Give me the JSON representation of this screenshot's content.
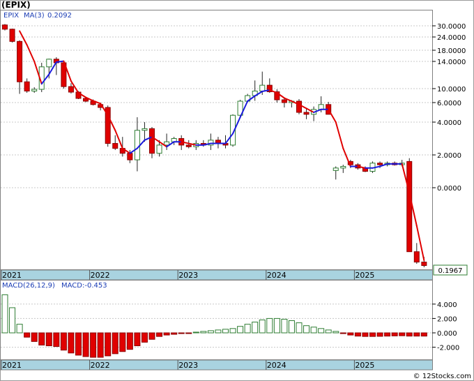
{
  "header": {
    "title": "(EPIX)"
  },
  "price_panel": {
    "ticker_label": "EPIX",
    "ma_label": "MA(3)",
    "ma_value": "0.2092",
    "last_price": "0.1967",
    "y_tick_labels": [
      "30.0000",
      "24.0000",
      "18.0000",
      "14.0000",
      "10.0000",
      "6.0000",
      "4.0000",
      "2.0000",
      "0.0000"
    ]
  },
  "macd_panel": {
    "label": "MACD(26,12,9)",
    "value_label": "MACD:-0.453",
    "y_tick_labels": [
      "4.000",
      "2.000",
      "0.000",
      "-2.000"
    ]
  },
  "x_axis": {
    "year_labels": [
      "2021",
      "2022",
      "2023",
      "2024",
      "2025"
    ]
  },
  "footer": {
    "credit": "© 12Stocks.com"
  },
  "colors": {
    "up": "#2e7d32",
    "down": "#e00000",
    "ma_up": "#1a1adc",
    "ma_down": "#e00000",
    "axis_band": "#a9d3e0"
  },
  "chart_data": [
    {
      "type": "candlestick",
      "title": "(EPIX)",
      "period": "monthly",
      "x_start": "2021-01",
      "yaxis_scale": "nonlinear (as printed)",
      "ohlc": [
        [
          30.5,
          31.0,
          27.5,
          28.2
        ],
        [
          28.2,
          28.5,
          21.5,
          22.0
        ],
        [
          22.0,
          22.5,
          8.5,
          11.0
        ],
        [
          11.0,
          11.5,
          8.8,
          9.3
        ],
        [
          9.3,
          10.2,
          8.8,
          9.8
        ],
        [
          9.8,
          13.8,
          9.0,
          13.2
        ],
        [
          13.2,
          15.0,
          11.5,
          14.8
        ],
        [
          14.8,
          15.5,
          12.0,
          13.8
        ],
        [
          13.8,
          14.2,
          10.0,
          10.3
        ],
        [
          10.3,
          10.8,
          8.6,
          9.0
        ],
        [
          9.0,
          9.3,
          7.0,
          7.2
        ],
        [
          7.2,
          7.6,
          6.1,
          6.4
        ],
        [
          6.4,
          6.9,
          5.7,
          5.8
        ],
        [
          5.8,
          6.0,
          5.2,
          5.5
        ],
        [
          5.5,
          5.7,
          2.5,
          2.7
        ],
        [
          2.7,
          3.2,
          2.3,
          2.4
        ],
        [
          2.4,
          3.1,
          1.9,
          2.1
        ],
        [
          2.1,
          2.3,
          1.5,
          1.7
        ],
        [
          1.7,
          4.5,
          1.0,
          3.5
        ],
        [
          3.5,
          4.0,
          2.8,
          3.6
        ],
        [
          3.6,
          3.7,
          1.8,
          2.1
        ],
        [
          2.1,
          2.9,
          1.9,
          2.6
        ],
        [
          2.6,
          3.3,
          2.3,
          2.8
        ],
        [
          2.8,
          3.1,
          2.6,
          3.0
        ],
        [
          3.0,
          3.2,
          2.3,
          2.6
        ],
        [
          2.6,
          2.9,
          2.4,
          2.5
        ],
        [
          2.5,
          2.9,
          2.3,
          2.7
        ],
        [
          2.7,
          2.9,
          2.5,
          2.6
        ],
        [
          2.6,
          3.3,
          2.3,
          2.9
        ],
        [
          2.9,
          3.1,
          2.4,
          2.7
        ],
        [
          2.7,
          3.2,
          2.4,
          2.6
        ],
        [
          2.6,
          4.8,
          2.5,
          4.7
        ],
        [
          4.7,
          6.8,
          4.5,
          6.4
        ],
        [
          6.4,
          8.5,
          6.0,
          8.0
        ],
        [
          8.0,
          11.2,
          6.5,
          9.3
        ],
        [
          9.3,
          12.5,
          8.2,
          10.5
        ],
        [
          10.5,
          11.5,
          8.8,
          9.1
        ],
        [
          9.1,
          9.8,
          6.0,
          6.8
        ],
        [
          6.8,
          7.2,
          5.5,
          6.0
        ],
        [
          6.0,
          6.7,
          5.5,
          6.4
        ],
        [
          6.4,
          7.0,
          4.8,
          5.0
        ],
        [
          5.0,
          5.4,
          4.3,
          4.8
        ],
        [
          4.8,
          5.6,
          4.1,
          5.3
        ],
        [
          5.3,
          7.8,
          5.0,
          5.8
        ],
        [
          5.8,
          6.2,
          5.2,
          4.8
        ],
        [
          1.05,
          1.3,
          0.5,
          1.2
        ],
        [
          1.2,
          1.4,
          0.9,
          1.3
        ],
        [
          1.6,
          1.7,
          1.2,
          1.4
        ],
        [
          1.4,
          1.5,
          1.1,
          1.2
        ],
        [
          1.2,
          1.3,
          0.95,
          1.0
        ],
        [
          1.0,
          1.6,
          0.9,
          1.5
        ],
        [
          1.5,
          1.6,
          1.2,
          1.4
        ],
        [
          1.4,
          1.6,
          1.3,
          1.5
        ],
        [
          1.5,
          1.6,
          1.35,
          1.4
        ],
        [
          1.4,
          1.7,
          1.3,
          1.5
        ],
        [
          1.6,
          1.8,
          1.0,
          -3.7
        ],
        [
          -3.7,
          -3.2,
          -4.4,
          -4.3
        ],
        [
          -4.3,
          -4.0,
          -4.6,
          -4.5
        ]
      ],
      "ma3": [
        null,
        null,
        27.2,
        20.4,
        14.0,
        10.7,
        12.1,
        13.9,
        14.1,
        11.1,
        8.8,
        7.5,
        6.5,
        5.9,
        4.7,
        3.5,
        2.4,
        2.1,
        2.4,
        2.9,
        3.1,
        2.8,
        2.5,
        2.8,
        2.8,
        2.7,
        2.6,
        2.6,
        2.7,
        2.7,
        2.7,
        3.3,
        4.5,
        6.4,
        7.9,
        9.2,
        9.6,
        8.8,
        7.3,
        6.4,
        5.8,
        5.4,
        5.0,
        5.3,
        5.3,
        4.0,
        2.4,
        1.3,
        1.3,
        1.2,
        1.2,
        1.3,
        1.45,
        1.45,
        1.45,
        -0.3,
        -2.2,
        -4.2
      ]
    },
    {
      "type": "bar",
      "title": "MACD(26,12,9)",
      "ylim": [
        -3.6,
        5.3
      ],
      "values": [
        5.3,
        3.5,
        1.2,
        -0.6,
        -1.2,
        -1.7,
        -1.8,
        -1.9,
        -2.4,
        -2.8,
        -3.1,
        -3.3,
        -3.4,
        -3.4,
        -3.2,
        -2.9,
        -2.6,
        -2.3,
        -1.8,
        -1.3,
        -0.9,
        -0.5,
        -0.3,
        -0.2,
        -0.1,
        -0.05,
        0.1,
        0.2,
        0.3,
        0.4,
        0.5,
        0.6,
        0.9,
        1.2,
        1.5,
        1.8,
        2.0,
        2.0,
        1.9,
        1.7,
        1.4,
        1.0,
        0.8,
        0.6,
        0.4,
        0.2,
        -0.1,
        -0.3,
        -0.45,
        -0.5,
        -0.5,
        -0.48,
        -0.45,
        -0.42,
        -0.4,
        -0.45,
        -0.45,
        -0.45
      ]
    }
  ]
}
